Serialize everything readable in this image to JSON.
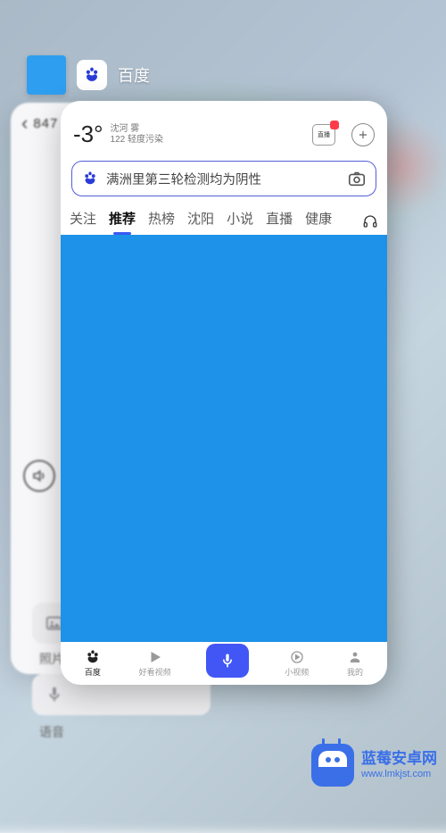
{
  "app_bar": {
    "name": "百度"
  },
  "back_card": {
    "title": "847",
    "speak_label": "语音",
    "photo_label": "照片",
    "voice_label": "语音"
  },
  "weather": {
    "temp": "-3°",
    "line1": "沈河 雾",
    "line2": "122 轻度污染",
    "live_label": "直播"
  },
  "search": {
    "placeholder": "满洲里第三轮检测均为阴性"
  },
  "tabs": [
    {
      "label": "关注",
      "active": false
    },
    {
      "label": "推荐",
      "active": true
    },
    {
      "label": "热榜",
      "active": false
    },
    {
      "label": "沈阳",
      "active": false
    },
    {
      "label": "小说",
      "active": false
    },
    {
      "label": "直播",
      "active": false
    },
    {
      "label": "健康",
      "active": false
    }
  ],
  "bottom_nav": {
    "items": [
      {
        "label": "百度"
      },
      {
        "label": "好看视频"
      },
      {
        "label": "小视频"
      },
      {
        "label": "我的"
      }
    ]
  },
  "watermark": {
    "title": "蓝莓安卓网",
    "url": "www.lmkjst.com"
  },
  "colors": {
    "accent": "#4156f5",
    "content_blue": "#1d92e8",
    "brand_blue": "#2a3cd6"
  }
}
